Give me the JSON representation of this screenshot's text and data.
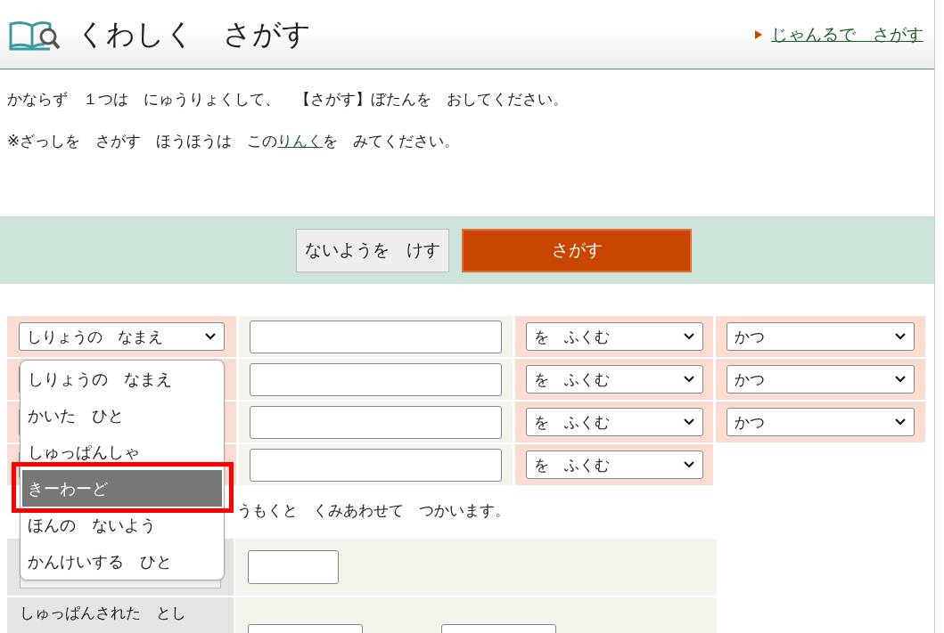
{
  "header": {
    "title": "くわしく　さがす",
    "genre_link": "じゃんるで　さがす"
  },
  "instructions": {
    "required_note": "かならず　１つは　にゅうりょくして、　【さがす】ぼたんを　おしてください。",
    "magazine_note": {
      "before": "※ざっしを　さがす　ほうほうは　この",
      "link": "りんく",
      "after": "を　みてください。"
    }
  },
  "actions": [
    {
      "label": "ないようを　けす",
      "kind": "clear"
    },
    {
      "label": "さがす",
      "kind": "search"
    }
  ],
  "criteria": [
    {
      "field": "しりょうの　なまえ",
      "match": "を　ふくむ",
      "joiner": "かつ"
    },
    {
      "match": "を　ふくむ",
      "joiner": "かつ"
    },
    {
      "match": "を　ふくむ",
      "joiner": "かつ"
    },
    {
      "match": "を　ふくむ"
    }
  ],
  "field_dropdown": {
    "options": [
      {
        "label": "しりょうの　なまえ",
        "selected": false,
        "highlighted": false
      },
      {
        "label": "かいた　ひと",
        "selected": false,
        "highlighted": false
      },
      {
        "label": "しゅっぱんしゃ",
        "selected": false,
        "highlighted": false
      },
      {
        "label": "きーわーど",
        "selected": true,
        "highlighted": true
      },
      {
        "label": "ほんの　ないよう",
        "selected": false,
        "highlighted": false
      },
      {
        "label": "かんけいする　ひと",
        "selected": false,
        "highlighted": false
      }
    ]
  },
  "combine_note": "うもくと　くみあわせて　つかいます。",
  "limits": [
    {
      "kind": "single"
    },
    {
      "kind": "range",
      "label": "しゅっぱんされた　とし"
    }
  ]
}
